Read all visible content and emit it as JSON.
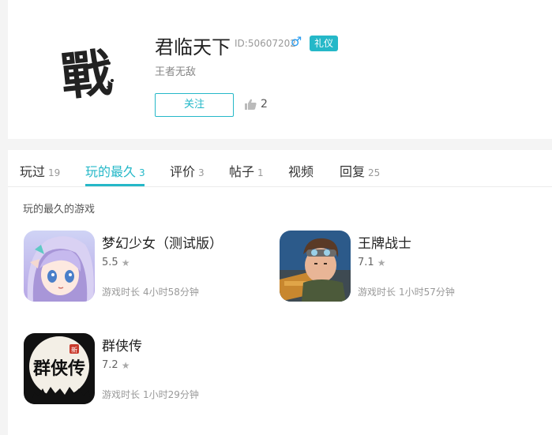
{
  "profile": {
    "username": "君临天下",
    "user_id": "ID:50607202",
    "gender_symbol": "♂",
    "badge": "礼仪",
    "bio": "王者无敌",
    "follow_label": "关注",
    "like_count": "2",
    "avatar_glyph": "戰"
  },
  "tabs": [
    {
      "label": "玩过",
      "count": "19"
    },
    {
      "label": "玩的最久",
      "count": "3"
    },
    {
      "label": "评价",
      "count": "3"
    },
    {
      "label": "帖子",
      "count": "1"
    },
    {
      "label": "视频",
      "count": ""
    },
    {
      "label": "回复",
      "count": "25"
    }
  ],
  "active_tab": "玩的最久",
  "section_title": "玩的最久的游戏",
  "games": [
    {
      "name": "梦幻少女（测试版）",
      "rating": "5.5",
      "time_label": "游戏时长",
      "time_value": "4小时58分钟",
      "icon": "anime-girl-icon"
    },
    {
      "name": "王牌战士",
      "rating": "7.1",
      "time_label": "游戏时长",
      "time_value": "1小时57分钟",
      "icon": "soldier-icon"
    },
    {
      "name": "群侠传",
      "rating": "7.2",
      "time_label": "游戏时长",
      "time_value": "1小时29分钟",
      "icon": "calligraphy-logo-icon",
      "logo_text": "群侠传",
      "logo_seal": "新"
    }
  ],
  "colors": {
    "accent": "#25b8c8",
    "male": "#2b9df0"
  }
}
